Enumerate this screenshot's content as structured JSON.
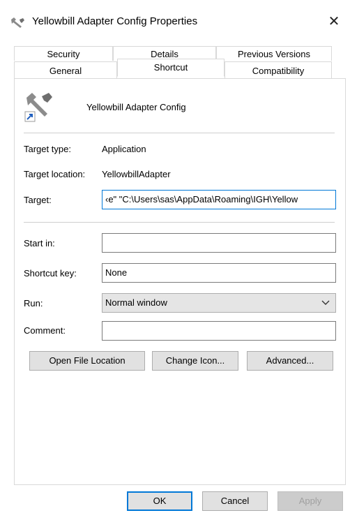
{
  "window": {
    "title": "Yellowbill Adapter Config Properties",
    "close_glyph": "✕"
  },
  "tabs": {
    "row1": [
      "Security",
      "Details",
      "Previous Versions"
    ],
    "row2": [
      "General",
      "Shortcut",
      "Compatibility"
    ],
    "active": "Shortcut"
  },
  "shortcut": {
    "app_name": "Yellowbill Adapter Config",
    "target_type_label": "Target type:",
    "target_type_value": "Application",
    "target_location_label": "Target location:",
    "target_location_value": "YellowbillAdapter",
    "target_label": "Target:",
    "target_value": "‹e\" \"C:\\Users\\sas\\AppData\\Roaming\\IGH\\Yellow",
    "start_in_label": "Start in:",
    "start_in_value": "",
    "shortcut_key_label": "Shortcut key:",
    "shortcut_key_value": "None",
    "run_label": "Run:",
    "run_value": "Normal window",
    "comment_label": "Comment:",
    "comment_value": ""
  },
  "buttons": {
    "open_file_location": "Open File Location",
    "change_icon": "Change Icon...",
    "advanced": "Advanced...",
    "ok": "OK",
    "cancel": "Cancel",
    "apply": "Apply"
  },
  "colors": {
    "focus_accent": "#0078d7",
    "button_face": "#e1e1e1"
  },
  "icons": {
    "title": "wrench-shortcut-icon",
    "app": "wrench-icon",
    "shortcut_overlay": "shortcut-arrow-icon",
    "run_dropdown": "chevron-down-icon",
    "close": "close-icon"
  }
}
